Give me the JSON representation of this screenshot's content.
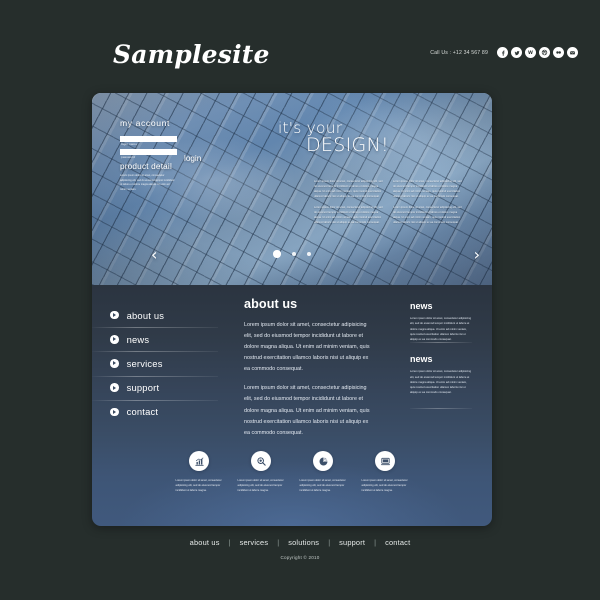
{
  "header": {
    "brand": "Samplesite",
    "phone": "Call Us : +12 34 567 89",
    "social": [
      {
        "name": "facebook-icon",
        "glyph": "f"
      },
      {
        "name": "twitter-icon",
        "glyph": "t"
      },
      {
        "name": "wordpress-icon",
        "glyph": "W"
      },
      {
        "name": "dribbble-icon",
        "glyph": "d"
      },
      {
        "name": "flickr-icon",
        "glyph": "oo"
      },
      {
        "name": "email-icon",
        "glyph": "@"
      }
    ]
  },
  "hero": {
    "account": {
      "title": "my account",
      "login_name_label": "login name",
      "login_name_value": "",
      "password_label": "password",
      "password_value": "",
      "login_button": "login"
    },
    "product": {
      "title": "product detail",
      "body": "Lorem ipsum dolor sit amet, consectetur adipisicing elit, sed do eiusmod tempor incididunt ut labore et dolore magna aliqua. Ut enim ad minim veniam."
    },
    "headline_line1": "it's your",
    "headline_line2": "DESIGN!",
    "columns": [
      {
        "paragraphs": [
          "Lorem ipsum dolor sit amet, consectetur adipisicing elit, sed do eiusmod tempor incididunt ut labore et dolore magna aliqua. Ut enim ad minim veniam, quis nostrud exercitation ullamco laboris nisi ut aliquip ex ea commodo consequat.",
          "Lorem ipsum dolor sit amet, consectetur adipisicing elit, sed do eiusmod tempor incididunt ut labore et dolore magna aliqua. Ut enim ad minim veniam, quis nostrud exercitation ullamco laboris nisi ut aliquip ex ea commodo consequat."
        ]
      },
      {
        "paragraphs": [
          "Lorem ipsum dolor sit amet, consectetur adipisicing elit, sed do eiusmod tempor incididunt ut labore et dolore magna aliqua. Ut enim ad minim veniam, quis nostrud exercitation ullamco laboris nisi ut aliquip ex ea commodo consequat.",
          "Lorem ipsum dolor sit amet, consectetur adipisicing elit, sed do eiusmod tempor incididunt ut labore et dolore magna aliqua. Ut enim ad minim veniam, quis nostrud exercitation ullamco laboris nisi ut aliquip ex ea commodo consequat."
        ]
      }
    ],
    "prev_arrow": "‹",
    "next_arrow": "›",
    "slides": 3,
    "active_slide": 1
  },
  "nav": {
    "items": [
      {
        "label": "about us"
      },
      {
        "label": "news"
      },
      {
        "label": "services"
      },
      {
        "label": "support"
      },
      {
        "label": "contact"
      }
    ]
  },
  "content": {
    "title": "about us",
    "paragraphs": [
      "Lorem ipsum dolor sit amet, consectetur adipisicing elit, sed do eiusmod tempor incididunt ut labore et dolore magna aliqua. Ut enim ad minim veniam, quis nostrud exercitation ullamco laboris nisi ut aliquip ex ea commodo consequat.",
      "Lorem ipsum dolor sit amet, consectetur adipisicing elit, sed do eiusmod tempor incididunt ut labore et dolore magna aliqua. Ut enim ad minim veniam, quis nostrud exercitation ullamco laboris nisi ut aliquip ex ea commodo consequat."
    ]
  },
  "aside": {
    "blocks": [
      {
        "title": "news",
        "body": "Lorem ipsum dolor sit amet, consectetur adipisicing elit, sed do eiusmod tempor incididunt ut labore et dolore magna aliqua. Ut enim ad minim veniam, quis nostrud exercitation ullamco laboris nisi ut aliquip ex ea commodo consequat."
      },
      {
        "title": "news",
        "body": "Lorem ipsum dolor sit amet, consectetur adipisicing elit, sed do eiusmod tempor incididunt ut labore et dolore magna aliqua. Ut enim ad minim veniam, quis nostrud exercitation ullamco laboris nisi ut aliquip ex ea commodo consequat."
      }
    ]
  },
  "features": [
    {
      "icon": "bar-chart-icon",
      "text": "Lorem ipsum dolor sit amet, consectetur adipisicing elit, sed do eiusmod tempor incididunt ut labore magna."
    },
    {
      "icon": "search-settings-icon",
      "text": "Lorem ipsum dolor sit amet, consectetur adipisicing elit, sed do eiusmod tempor incididunt ut labore magna."
    },
    {
      "icon": "pie-chart-icon",
      "text": "Lorem ipsum dolor sit amet, consectetur adipisicing elit, sed do eiusmod tempor incididunt ut labore magna."
    },
    {
      "icon": "desktop-monitor-icon",
      "text": "Lorem ipsum dolor sit amet, consectetur adipisicing elit, sed do eiusmod tempor incididunt ut labore magna."
    }
  ],
  "footer": {
    "links": [
      "about us",
      "services",
      "solutions",
      "support",
      "contact"
    ],
    "separator": "|",
    "copyright": "Copyright © 2010"
  },
  "colors": {
    "page_background": "#262e2c",
    "card_body_top": "#2b3440",
    "card_body_bottom": "#40597d",
    "accent_white": "#ffffff"
  }
}
